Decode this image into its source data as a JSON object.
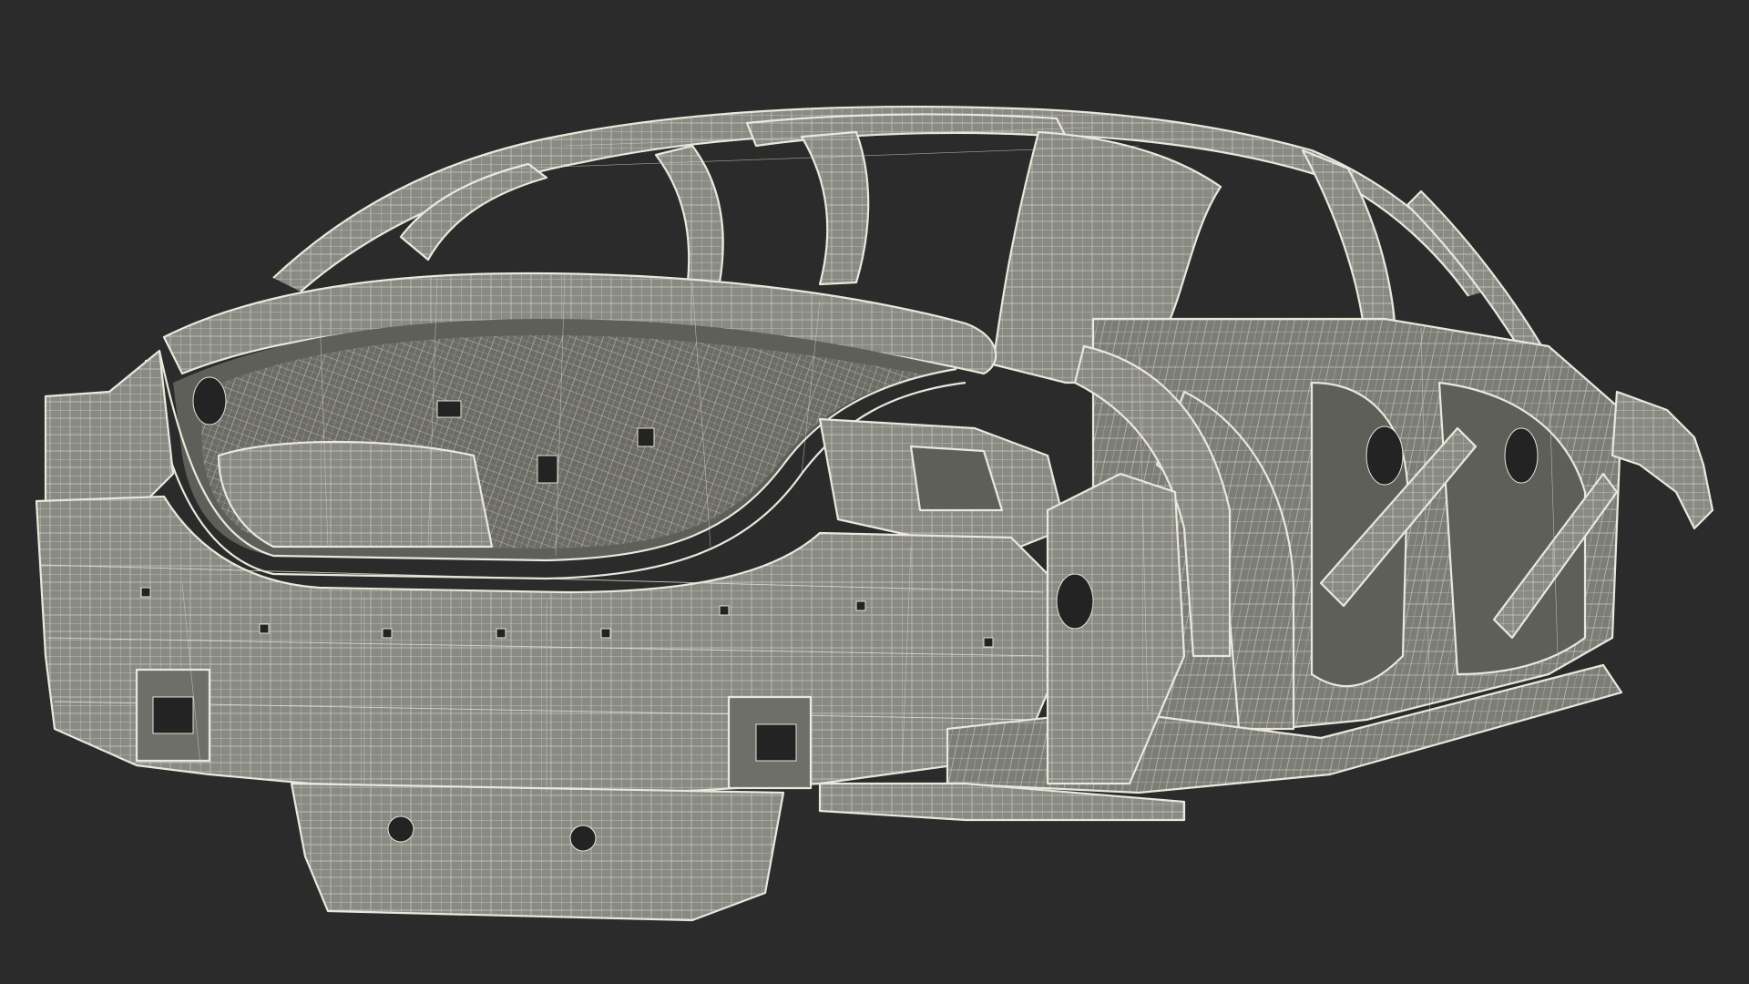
{
  "scene": {
    "subject": "car-body-in-white-wireframe",
    "background_color": "#2b2b2b",
    "body_color": "#8a8a84",
    "wire_color": "#e3e3d6"
  }
}
